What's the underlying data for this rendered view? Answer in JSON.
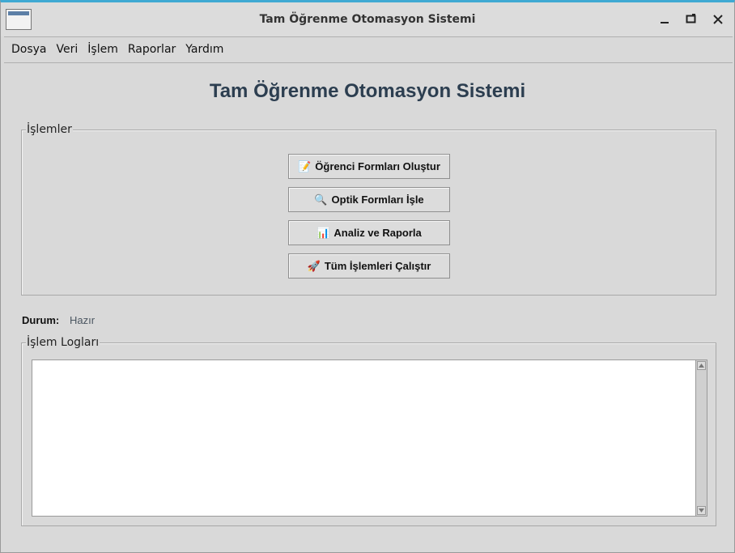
{
  "window": {
    "title": "Tam Öğrenme Otomasyon Sistemi",
    "accent": "#3fa9d3"
  },
  "menu": {
    "items": [
      "Dosya",
      "Veri",
      "İşlem",
      "Raporlar",
      "Yardım"
    ]
  },
  "main": {
    "heading": "Tam Öğrenme Otomasyon Sistemi",
    "heading_color": "#2c3e50"
  },
  "operations": {
    "group_label": "İşlemler",
    "buttons": [
      {
        "emoji": "📝",
        "label": "Öğrenci Formları Oluştur"
      },
      {
        "emoji": "🔍",
        "label": "Optik Formları İşle"
      },
      {
        "emoji": "📊",
        "label": "Analiz ve Raporla"
      },
      {
        "emoji": "🚀",
        "label": "Tüm İşlemleri Çalıştır"
      }
    ]
  },
  "status": {
    "label": "Durum:",
    "value": "Hazır"
  },
  "logs": {
    "group_label": "İşlem Logları",
    "content": ""
  },
  "icons": {
    "app": "window-icon",
    "minimize": "minimize-icon",
    "maximize": "maximize-icon",
    "close": "close-icon",
    "scroll_up": "arrow-up-icon",
    "scroll_down": "arrow-down-icon"
  }
}
